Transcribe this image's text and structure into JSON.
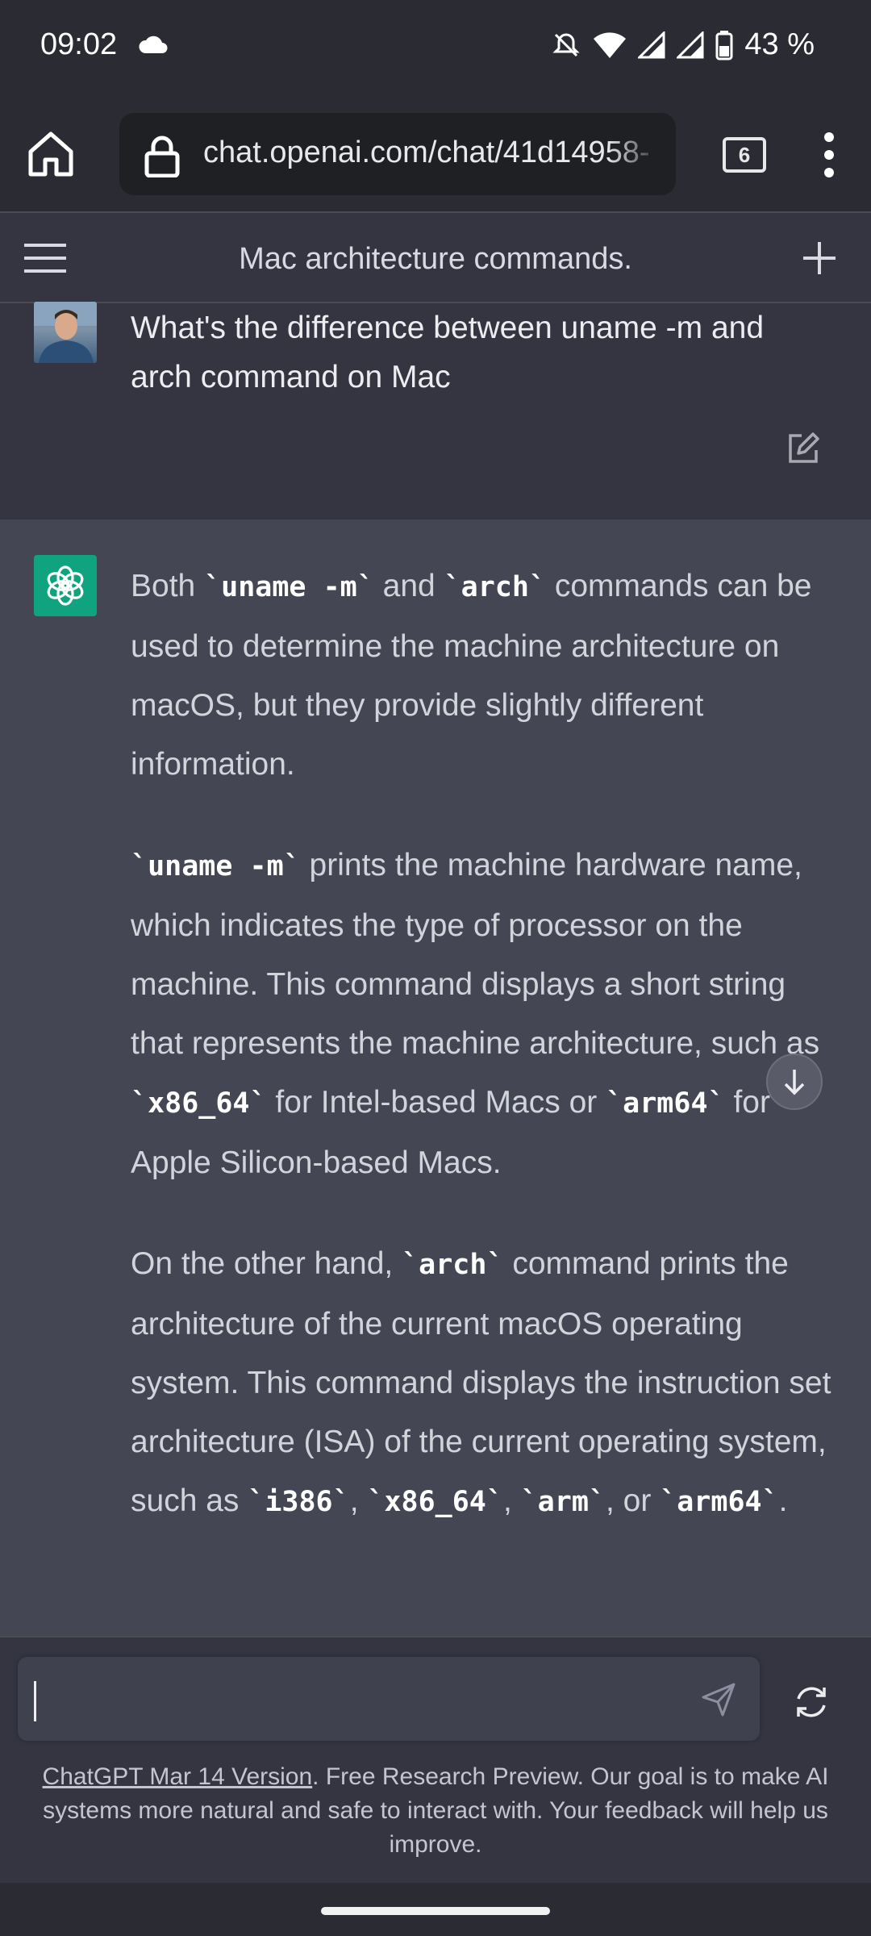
{
  "status": {
    "time": "09:02",
    "battery": "43 %"
  },
  "browser": {
    "url": "chat.openai.com/chat/41d14958-",
    "tabs_count": "6"
  },
  "chat": {
    "title": "Mac architecture commands."
  },
  "user_message": {
    "text": "What's the difference between uname -m and arch command on Mac"
  },
  "assistant_message": {
    "p1": {
      "t1": "Both ",
      "c1": "`uname -m`",
      "t2": " and ",
      "c2": "`arch`",
      "t3": " commands can be used to determine the machine architecture on macOS, but they provide slightly different information."
    },
    "p2": {
      "c1": "`uname -m`",
      "t1": " prints the machine hardware name, which indicates the type of processor on the machine. This command displays a short string that represents the machine architecture, such as ",
      "c2": "`x86_64`",
      "t2": " for Intel-based Macs or ",
      "c3": "`arm64`",
      "t3": " for Apple Silicon-based Macs."
    },
    "p3": {
      "t1": "On the other hand, ",
      "c1": "`arch`",
      "t2": " command prints the architecture of the current macOS operating system. This command displays the instruction set architecture (ISA) of the current operating system, such as ",
      "c2": "`i386`",
      "t3": ", ",
      "c3": "`x86_64`",
      "t4": ", ",
      "c4": "`arm`",
      "t5": ", or ",
      "c5": "`arm64`",
      "t6": "."
    }
  },
  "footer": {
    "link": "ChatGPT Mar 14 Version",
    "text": ". Free Research Preview. Our goal is to make AI systems more natural and safe to interact with. Your feedback will help us improve."
  },
  "icons": {
    "home": "home-icon",
    "lock": "lock-icon",
    "menu": "more-vert-icon",
    "hamburger": "hamburger-icon",
    "plus": "plus-icon",
    "edit": "edit-icon",
    "send": "send-icon",
    "regenerate": "regenerate-icon",
    "scroll": "arrow-down-icon"
  },
  "colors": {
    "background": "#343541",
    "assistant_bg": "#444654",
    "gpt_green": "#10a37f"
  }
}
